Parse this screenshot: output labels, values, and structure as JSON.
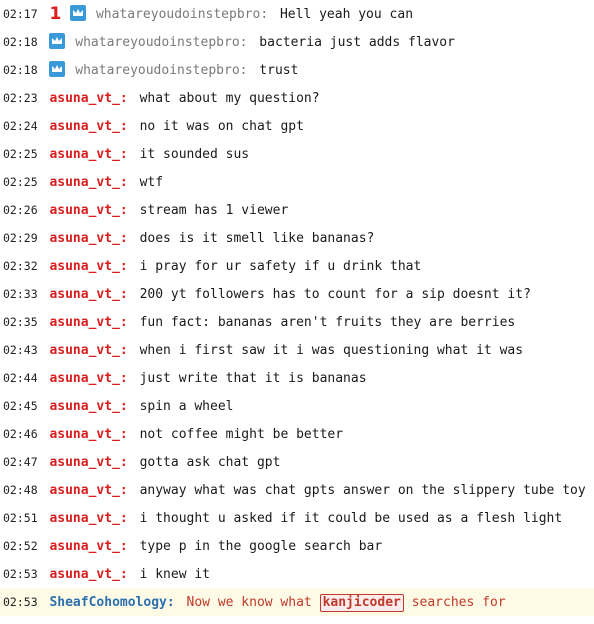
{
  "colors": {
    "sub_badge": "#3a9ad9",
    "rank_badge": "#e01b1b",
    "user_red": "#d81e1e",
    "user_grey": "#7a7a7a",
    "user_blue": "#2e6fb0",
    "highlight_bg": "#fdfbe5"
  },
  "messages": [
    {
      "time": "02:17",
      "user": "whatareyoudoinstepbro:",
      "text": "Hell yeah you can",
      "rank_badge": "1",
      "sub_badge": "crown-icon"
    },
    {
      "time": "02:18",
      "user": "whatareyoudoinstepbro:",
      "text": "bacteria just adds flavor",
      "sub_badge": "crown-icon"
    },
    {
      "time": "02:18",
      "user": "whatareyoudoinstepbro:",
      "text": "trust",
      "sub_badge": "crown-icon"
    },
    {
      "time": "02:23",
      "user": "asuna_vt_:",
      "text": "what about my question?"
    },
    {
      "time": "02:24",
      "user": "asuna_vt_:",
      "text": "no it was on chat gpt"
    },
    {
      "time": "02:25",
      "user": "asuna_vt_:",
      "text": "it sounded sus"
    },
    {
      "time": "02:25",
      "user": "asuna_vt_:",
      "text": "wtf"
    },
    {
      "time": "02:26",
      "user": "asuna_vt_:",
      "text": "stream has 1 viewer"
    },
    {
      "time": "02:29",
      "user": "asuna_vt_:",
      "text": "does is it smell like bananas?"
    },
    {
      "time": "02:32",
      "user": "asuna_vt_:",
      "text": "i pray for ur safety if u drink that"
    },
    {
      "time": "02:33",
      "user": "asuna_vt_:",
      "text": "200 yt followers has to count for a sip doesnt it?"
    },
    {
      "time": "02:35",
      "user": "asuna_vt_:",
      "text": "fun fact: bananas aren't fruits they are berries"
    },
    {
      "time": "02:43",
      "user": "asuna_vt_:",
      "text": "when i first saw it i was questioning what it was"
    },
    {
      "time": "02:44",
      "user": "asuna_vt_:",
      "text": "just write that it is bananas"
    },
    {
      "time": "02:45",
      "user": "asuna_vt_:",
      "text": "spin a wheel"
    },
    {
      "time": "02:46",
      "user": "asuna_vt_:",
      "text": "not coffee might be better"
    },
    {
      "time": "02:47",
      "user": "asuna_vt_:",
      "text": "gotta ask chat gpt"
    },
    {
      "time": "02:48",
      "user": "asuna_vt_:",
      "text": "anyway what was chat gpts answer on the slippery tube toy"
    },
    {
      "time": "02:51",
      "user": "asuna_vt_:",
      "text": "i thought u asked if it could be used as a flesh light"
    },
    {
      "time": "02:52",
      "user": "asuna_vt_:",
      "text": "type p in the google search bar"
    },
    {
      "time": "02:53",
      "user": "asuna_vt_:",
      "text": "i knew it"
    }
  ],
  "highlighted": {
    "time": "02:53",
    "user": "SheafCohomology:",
    "text_before": "Now we know what",
    "mention": "kanjicoder",
    "text_after": "searches for"
  }
}
